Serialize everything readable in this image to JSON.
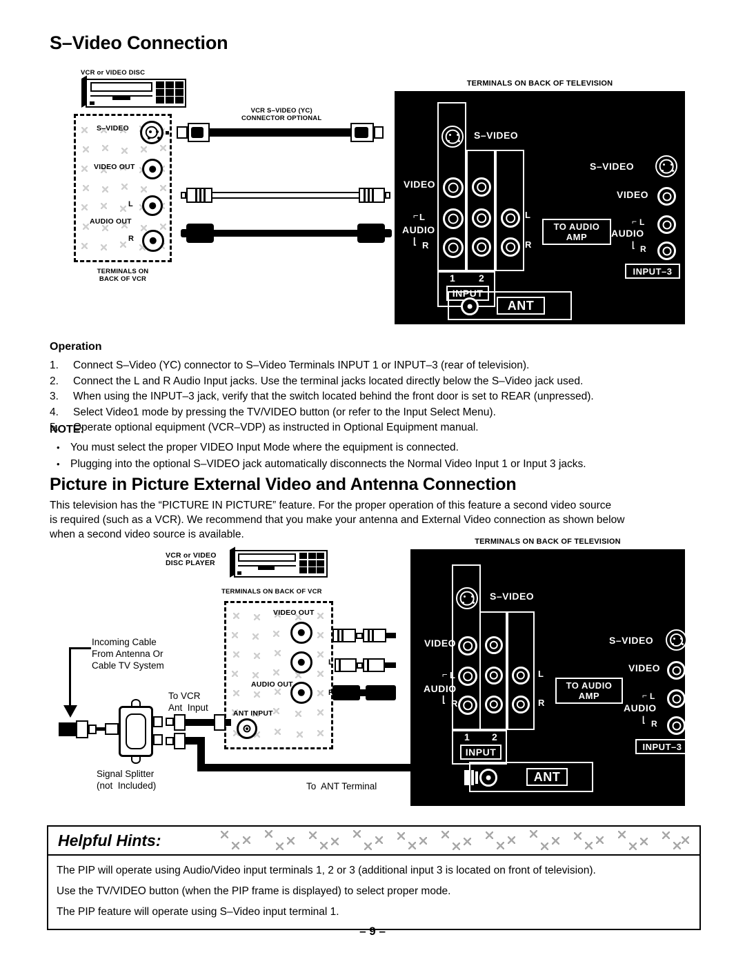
{
  "document": {
    "page_number": "– 9 –"
  },
  "section_svideo": {
    "heading": "S–Video Connection",
    "operation_title": "Operation",
    "steps": [
      {
        "num": "1.",
        "text": "Connect S–Video (YC) connector to S–Video Terminals INPUT 1 or INPUT–3 (rear of television)."
      },
      {
        "num": "2.",
        "text": "Connect the L and R Audio Input jacks. Use the terminal jacks located directly below the S–Video jack used."
      },
      {
        "num": "3.",
        "text": "When using the INPUT–3 jack, verify that the switch located behind the front door is set to REAR (unpressed)."
      },
      {
        "num": "4.",
        "text": "Select Video1 mode by pressing the TV/VIDEO button (or refer to the Input Select Menu)."
      },
      {
        "num": "5.",
        "text": "Operate optional equipment (VCR–VDP) as instructed in Optional Equipment manual."
      }
    ],
    "note_title": "NOTE:",
    "notes": [
      "You must select the proper VIDEO Input Mode where the equipment is connected.",
      "Plugging into the optional S–VIDEO jack automatically disconnects the Normal Video Input 1 or Input 3 jacks."
    ]
  },
  "diagram1": {
    "vcr_caption": "VCR or VIDEO DISC",
    "vcr_terminals_caption": "TERMINALS ON\nBACK OF VCR",
    "vcr_labels": {
      "svideo": "S–VIDEO",
      "video_out": "VIDEO OUT",
      "audio_out": "AUDIO OUT",
      "left": "L",
      "right": "R"
    },
    "cable_caption": "VCR S–VIDEO (YC)\nCONNECTOR OPTIONAL",
    "tv_caption": "TERMINALS ON BACK OF TELEVISION",
    "tv_labels": {
      "svideo": "S–VIDEO",
      "video": "VIDEO",
      "audio": "AUDIO",
      "left": "L",
      "right": "R",
      "input": "INPUT",
      "input_1": "1",
      "input_2": "2",
      "to_audio_amp": "TO AUDIO\nAMP",
      "amp_left": "L",
      "amp_right": "R",
      "svideo_right": "S–VIDEO",
      "video_right": "VIDEO",
      "audio_right": "AUDIO",
      "right_left": "L",
      "right_right": "R",
      "input3": "INPUT–3",
      "ant": "ANT"
    }
  },
  "section_pip": {
    "heading": "Picture in Picture External Video and Antenna Connection",
    "intro": [
      "This television has the “PICTURE IN PICTURE” feature. For the proper operation of this feature a second video source",
      "is required (such as a VCR). We recommend that you make your antenna and External Video connection as shown below",
      "when a second video source is available."
    ]
  },
  "diagram2": {
    "vcr_caption": "VCR or VIDEO\nDISC PLAYER",
    "vcr_terminals_caption": "TERMINALS ON BACK OF VCR",
    "vcr_labels": {
      "video_out": "VIDEO OUT",
      "audio_out": "AUDIO OUT",
      "ant_input": "ANT INPUT",
      "left": "L",
      "right": "R"
    },
    "incoming_cable": "Incoming Cable\nFrom Antenna Or\nCable TV System",
    "to_vcr_ant_input": "To VCR\nAnt  Input",
    "signal_splitter": "Signal Splitter\n(not  Included)",
    "to_ant_terminal": "To  ANT Terminal",
    "tv_caption": "TERMINALS ON BACK OF TELEVISION",
    "tv_labels": {
      "svideo": "S–VIDEO",
      "video": "VIDEO",
      "audio": "AUDIO",
      "left": "L",
      "right": "R",
      "input": "INPUT",
      "input_1": "1",
      "input_2": "2",
      "to_audio_amp": "TO AUDIO\nAMP",
      "amp_left": "L",
      "amp_right": "R",
      "svideo_right": "S–VIDEO",
      "video_right": "VIDEO",
      "audio_right": "AUDIO",
      "right_left": "L",
      "right_right": "R",
      "input3": "INPUT–3",
      "ant": "ANT"
    }
  },
  "helpful_hints": {
    "title": "Helpful Hints:",
    "lines": [
      "The PIP will operate using Audio/Video input terminals 1, 2 or 3 (additional input 3 is located on front of television).",
      "Use the TV/VIDEO button (when the PIP frame is displayed) to select proper mode.",
      "The PIP feature will operate using S–Video input terminal 1."
    ]
  }
}
